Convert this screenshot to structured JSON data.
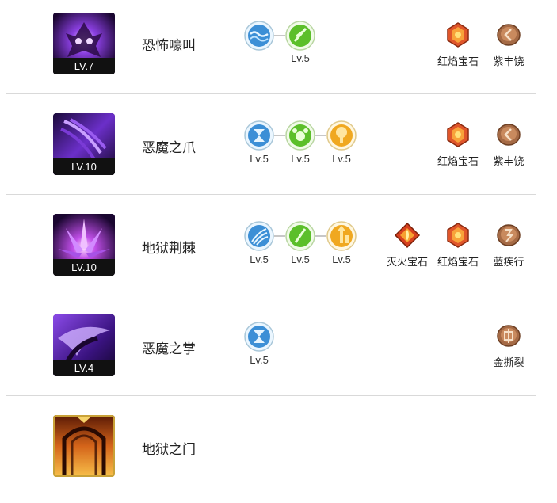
{
  "skills": [
    {
      "name": "恐怖嚎叫",
      "level": "LV.7",
      "runes": [
        {
          "icon": "wave-rune-icon",
          "level": ""
        },
        {
          "icon": "green-slash-rune-icon",
          "level": "Lv.5"
        }
      ],
      "gems": [
        {
          "icon": "red-ruby-gem-icon",
          "label": "红焰宝石"
        },
        {
          "icon": "bronze-rune-stone-icon",
          "label": "紫丰饶"
        }
      ]
    },
    {
      "name": "恶魔之爪",
      "level": "LV.10",
      "runes": [
        {
          "icon": "hourglass-rune-icon",
          "level": "Lv.5"
        },
        {
          "icon": "green-beast-rune-icon",
          "level": "Lv.5"
        },
        {
          "icon": "gold-tree-rune-icon",
          "level": "Lv.5"
        }
      ],
      "gems": [
        {
          "icon": "red-ruby-gem-icon",
          "label": "红焰宝石"
        },
        {
          "icon": "bronze-rune-stone-icon",
          "label": "紫丰饶"
        }
      ]
    },
    {
      "name": "地狱荆棘",
      "level": "LV.10",
      "runes": [
        {
          "icon": "blue-claw-rune-icon",
          "level": "Lv.5"
        },
        {
          "icon": "green-slash-rune-icon",
          "level": "Lv.5"
        },
        {
          "icon": "gold-arrow-up-rune-icon",
          "level": "Lv.5"
        }
      ],
      "gems": [
        {
          "icon": "fire-gem-icon",
          "label": "灭火宝石"
        },
        {
          "icon": "red-ruby-gem-icon",
          "label": "红焰宝石"
        },
        {
          "icon": "bronze-rune-stone-icon",
          "label": "蓝疾行"
        }
      ]
    },
    {
      "name": "恶魔之掌",
      "level": "LV.4",
      "runes": [
        {
          "icon": "hourglass-rune-icon",
          "level": "Lv.5"
        }
      ],
      "gems": [
        {
          "icon": "bronze-rune-stone-icon",
          "label": "金撕裂"
        }
      ]
    },
    {
      "name": "地狱之门",
      "level": "",
      "runes": [],
      "gems": []
    }
  ],
  "colors": {
    "purple_dark": "#2a0f4d",
    "purple_bright": "#b16cff",
    "gold_border": "#c9a238",
    "divider": "#d9d9d9"
  }
}
